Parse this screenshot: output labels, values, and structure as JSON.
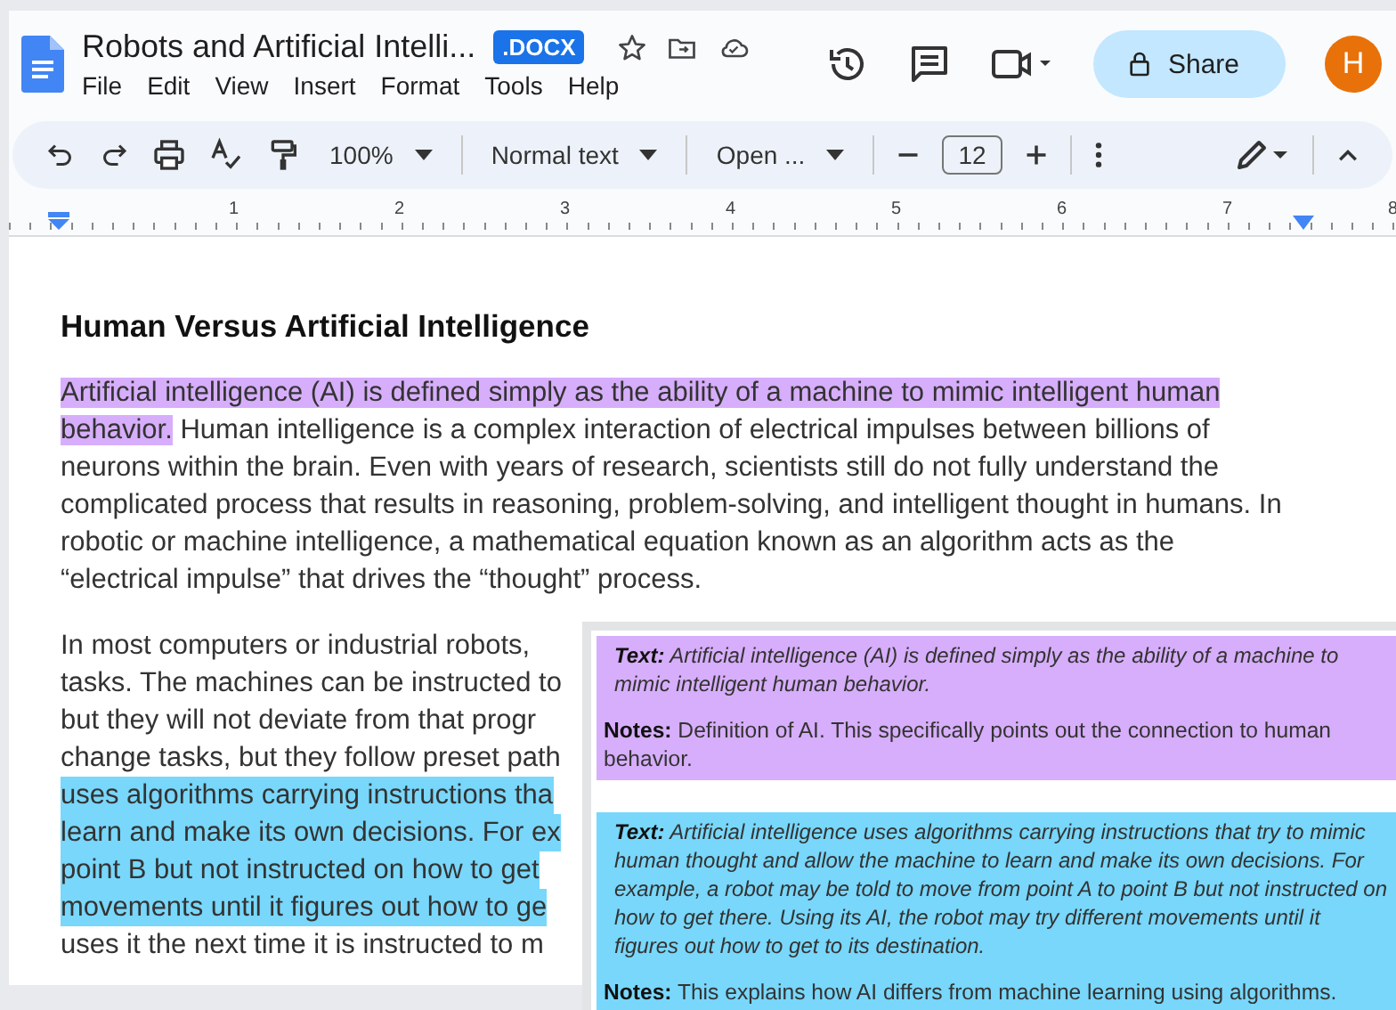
{
  "document": {
    "title": "Robots and Artificial Intelli...",
    "badge": ".DOCX"
  },
  "menu": [
    "File",
    "Edit",
    "View",
    "Insert",
    "Format",
    "Tools",
    "Help"
  ],
  "share_button": "Share",
  "avatar": "H",
  "toolbar": {
    "zoom": "100%",
    "style": "Normal text",
    "font": "Open ...",
    "font_size": "12"
  },
  "ruler": [
    "1",
    "2",
    "3",
    "4",
    "5",
    "6",
    "7",
    "8"
  ],
  "heading": "Human Versus Artificial Intelligence",
  "paragraphs": [
    {
      "kind": "segments",
      "segments": [
        {
          "text": "Artificial intelligence (AI) is defined simply as the ability of a machine to mimic intelligent human behavior.",
          "color": "#d7aefb"
        },
        {
          "text": " Human intelligence is a complex interaction of electrical impulses between billions of neurons within the brain. Even with years of research, scientists still do not fully understand the complicated process that results in reasoning, problem-solving, and intelligent thought in humans. In robotic or machine intelligence, a mathematical equation known as an algorithm acts as the “electrical impulse” that drives the “thought” process."
        }
      ]
    },
    {
      "kind": "lines",
      "lines": [
        {
          "text": "In most computers or industrial robots,"
        },
        {
          "text": "tasks. The machines can be instructed to"
        },
        {
          "text": "but they will not deviate from that progr"
        },
        {
          "text": "change tasks, but they follow preset path"
        },
        {
          "text": "uses algorithms carrying instructions tha",
          "color": "#78d7fb"
        },
        {
          "text": "learn and make its own decisions. For ex",
          "color": "#78d7fb"
        },
        {
          "text": "point B but not instructed on how to get",
          "color": "#78d7fb"
        },
        {
          "text": "movements until it figures out how to ge",
          "color": "#78d7fb"
        },
        {
          "text": "uses it the next time it is instructed to m"
        }
      ]
    }
  ],
  "comments": [
    {
      "color": "#d7aefb",
      "text_label": "Text:",
      "text": "Artificial intelligence (AI) is defined simply as the ability of a machine to mimic intelligent human behavior.",
      "notes_label": "Notes:",
      "notes": "Definition of AI. This specifically points out the connection to human behavior."
    },
    {
      "color": "#78d7fb",
      "text_label": "Text:",
      "text": "Artificial intelligence uses algorithms carrying instructions that try to mimic human thought and allow the machine to learn and make its own decisions. For example, a robot may be told to move from point A to point B but not instructed on how to get there. Using its AI, the robot may try different movements until it figures out how to get to its destination.",
      "notes_label": "Notes:",
      "notes": "This explains how AI differs from machine learning using algorithms."
    }
  ]
}
